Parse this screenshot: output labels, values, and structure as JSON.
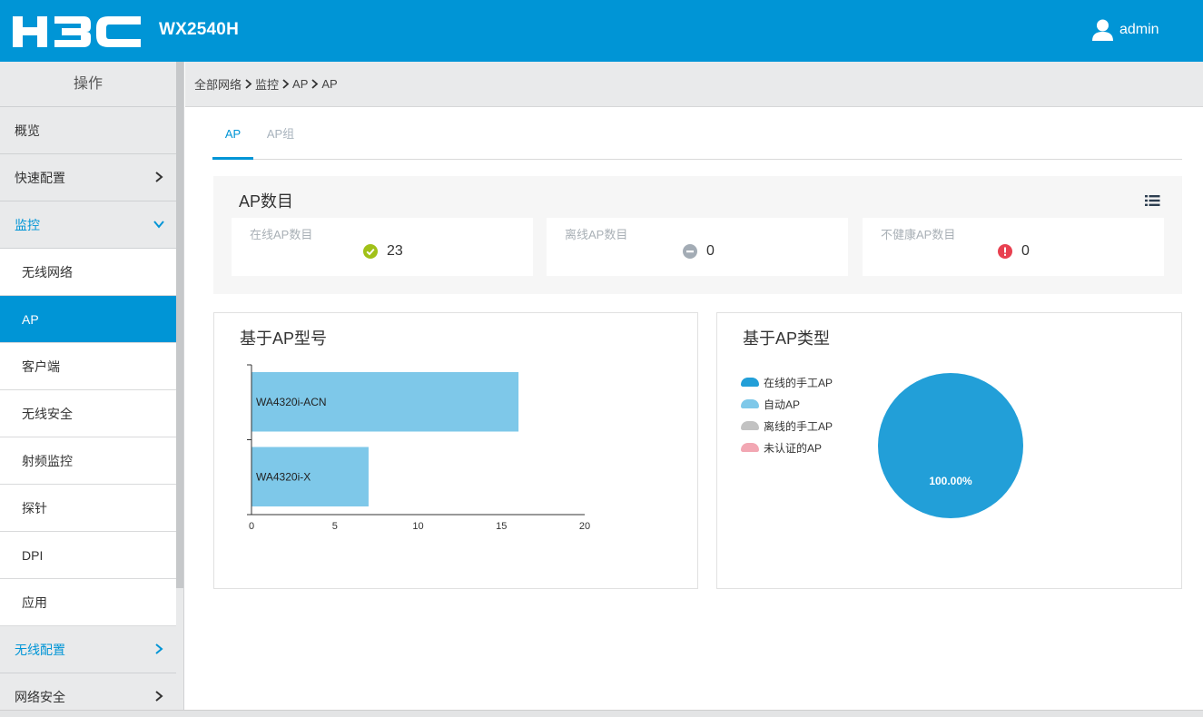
{
  "header": {
    "logo_text": "H3C",
    "model": "WX2540H",
    "user": "admin",
    "brand_color": "#0095d6"
  },
  "sidebar": {
    "title": "操作",
    "items": [
      {
        "label": "概览",
        "level": "top"
      },
      {
        "label": "快速配置",
        "level": "top",
        "arrow": "chevron-right"
      },
      {
        "label": "监控",
        "level": "top",
        "arrow": "chevron-down",
        "state": "open"
      },
      {
        "label": "无线网络",
        "level": "sub"
      },
      {
        "label": "AP",
        "level": "sub",
        "state": "active"
      },
      {
        "label": "客户端",
        "level": "sub"
      },
      {
        "label": "无线安全",
        "level": "sub"
      },
      {
        "label": "射频监控",
        "level": "sub"
      },
      {
        "label": "探针",
        "level": "sub"
      },
      {
        "label": "DPI",
        "level": "sub"
      },
      {
        "label": "应用",
        "level": "sub"
      },
      {
        "label": "无线配置",
        "level": "top",
        "arrow": "chevron-right",
        "state": "highlight"
      },
      {
        "label": "网络安全",
        "level": "top",
        "arrow": "chevron-right"
      }
    ]
  },
  "breadcrumb": [
    "全部网络",
    "监控",
    "AP",
    "AP"
  ],
  "tabs": [
    {
      "label": "AP",
      "active": true
    },
    {
      "label": "AP组",
      "active": false
    }
  ],
  "ap_count": {
    "title": "AP数目",
    "cards": [
      {
        "label": "在线AP数目",
        "value": "23",
        "icon": "check-circle-icon",
        "color": "#a1c118"
      },
      {
        "label": "离线AP数目",
        "value": "0",
        "icon": "minus-circle-icon",
        "color": "#a3acb5"
      },
      {
        "label": "不健康AP数目",
        "value": "0",
        "icon": "exclamation-circle-icon",
        "color": "#e84050"
      }
    ]
  },
  "model_chart": {
    "title": "基于AP型号"
  },
  "type_chart": {
    "title": "基于AP类型",
    "legend": [
      {
        "label": "在线的手工AP",
        "color": "#229fd8"
      },
      {
        "label": "自动AP",
        "color": "#7ec8e9"
      },
      {
        "label": "离线的手工AP",
        "color": "#c2c2c2"
      },
      {
        "label": "未认证的AP",
        "color": "#f2a7b3"
      }
    ],
    "slice_label": "100.00%"
  },
  "chart_data": [
    {
      "type": "bar",
      "orientation": "horizontal",
      "categories": [
        "WA4320i-ACN",
        "WA4320i-X"
      ],
      "values": [
        16,
        7
      ],
      "xlim": [
        0,
        20
      ],
      "xticks": [
        "0",
        "5",
        "10",
        "15",
        "20"
      ],
      "title": "基于AP型号",
      "bar_color": "#7ec8e9"
    },
    {
      "type": "pie",
      "title": "基于AP类型",
      "categories": [
        "在线的手工AP",
        "自动AP",
        "离线的手工AP",
        "未认证的AP"
      ],
      "values": [
        100,
        0,
        0,
        0
      ],
      "data_labels": [
        "100.00%"
      ],
      "legend_position": "left"
    }
  ]
}
